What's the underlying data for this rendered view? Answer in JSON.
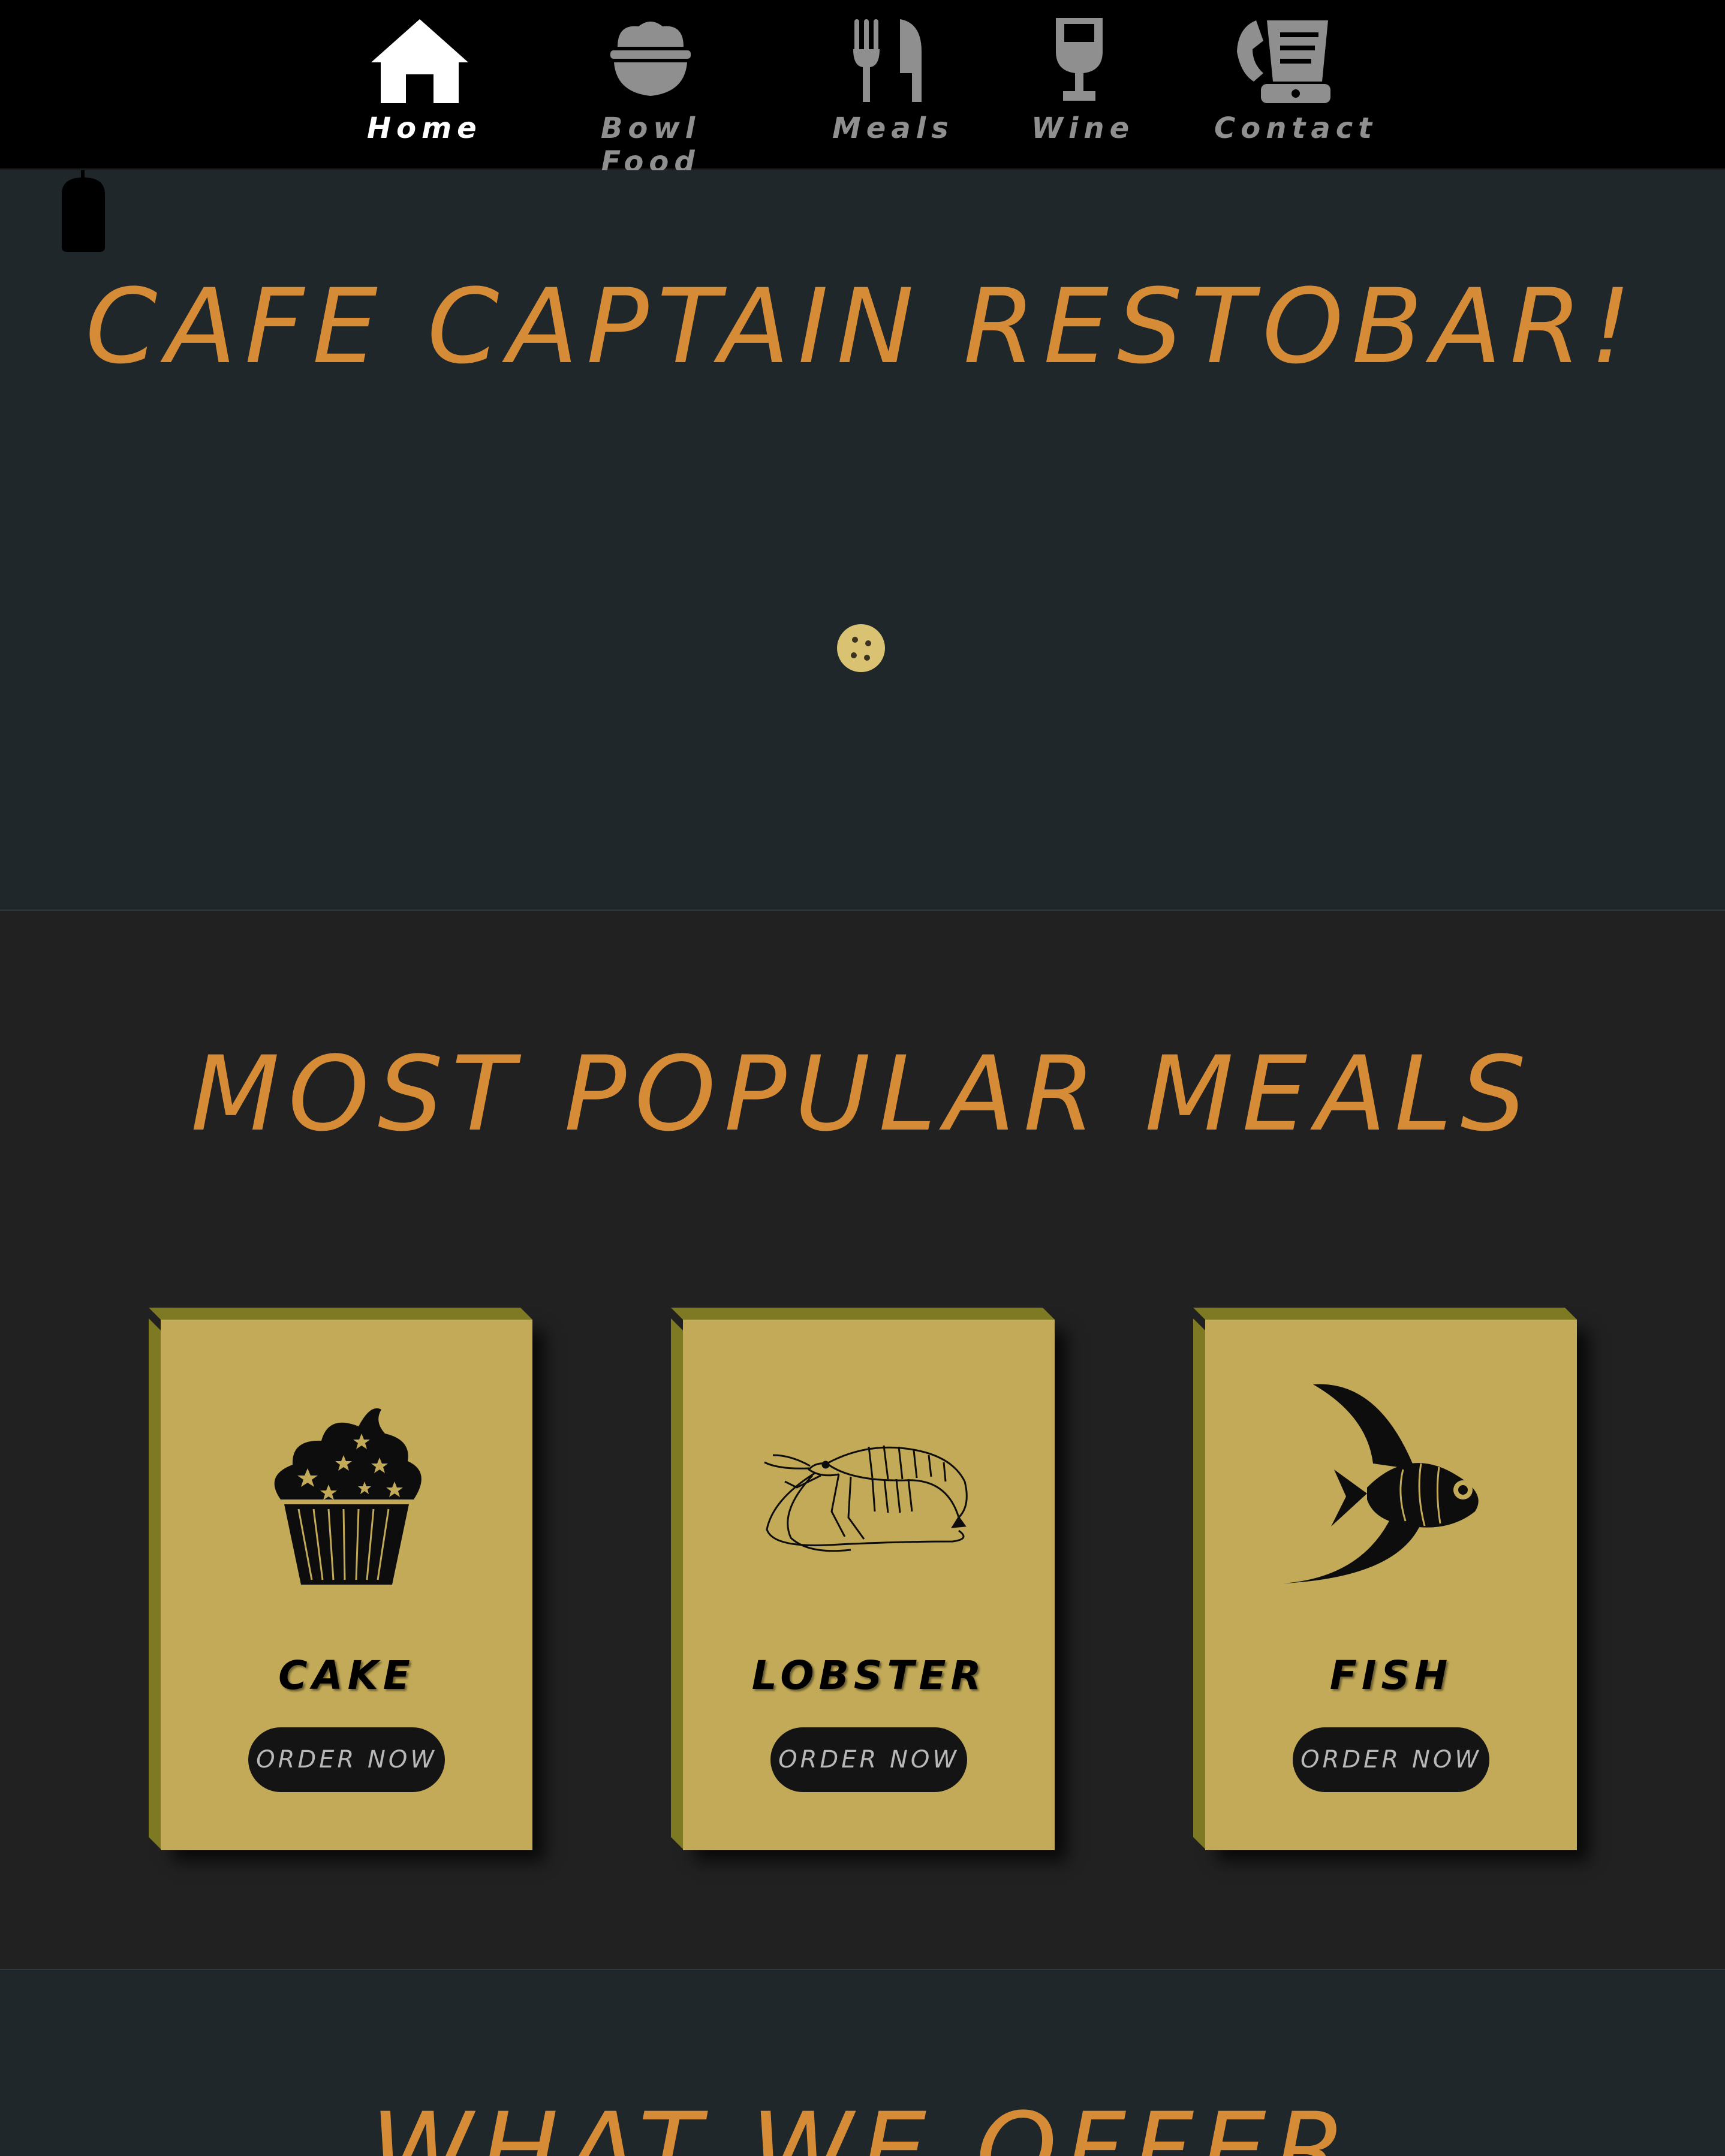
{
  "nav": {
    "items": [
      {
        "label": "Home",
        "icon": "home-icon",
        "active": true
      },
      {
        "label": "Bowl Food",
        "icon": "bowl-icon",
        "active": false
      },
      {
        "label": "Meals",
        "icon": "utensils-icon",
        "active": false
      },
      {
        "label": "Wine",
        "icon": "wine-glass-icon",
        "active": false
      },
      {
        "label": "Contact",
        "icon": "phone-icon",
        "active": false
      }
    ]
  },
  "hero": {
    "title": "CAFE CAPTAIN RESTOBAR!"
  },
  "popular": {
    "title": "MOST POPULAR MEALS",
    "cards": [
      {
        "name": "CAKE",
        "button": "ORDER NOW",
        "icon": "cupcake-icon"
      },
      {
        "name": "LOBSTER",
        "button": "ORDER NOW",
        "icon": "lobster-icon"
      },
      {
        "name": "FISH",
        "button": "ORDER NOW",
        "icon": "fish-icon"
      }
    ]
  },
  "offer": {
    "title": "WHAT WE OFFER"
  },
  "colors": {
    "nav_bg": "#000000",
    "hero_bg": "#1f272a",
    "section_bg": "#212121",
    "accent": "#d68c36",
    "card": "#c2aa58",
    "card_edge": "#7e7a24"
  }
}
